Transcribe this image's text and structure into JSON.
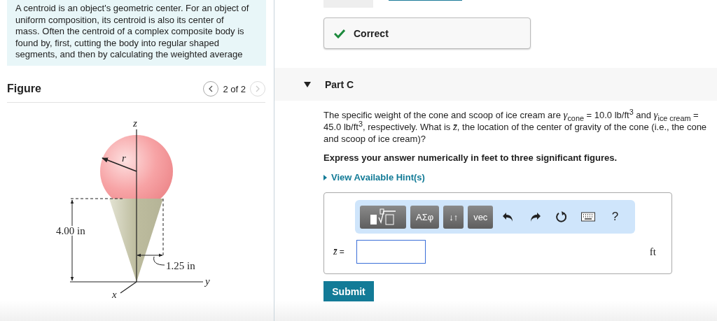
{
  "intro": {
    "text": "A centroid is an object's geometric center. For an object of uniform composition, its centroid is also its center of mass. Often the centroid of a complex composite body is found by, first, cutting the body into regular shaped segments, and then by calculating the weighted average"
  },
  "figure": {
    "title": "Figure",
    "pager": "2 of 2",
    "prev_disabled": false,
    "next_disabled": true,
    "labels": {
      "z_axis": "z",
      "radius": "r",
      "height": "4.00 in",
      "cone_radius": "1.25 in",
      "y_axis": "y",
      "x_axis": "x"
    }
  },
  "feedback": {
    "text": "Correct"
  },
  "part": {
    "title": "Part C",
    "expanded": true,
    "question": "The specific weight of the cone and scoop of ice cream are *γ*$_{cone}$ = 10.0 lb/ft$^{3}$ and *γ*$_{ice cream}$ = 45.0 lb/ft$^{3}$, respectively. What is *z̄*, the location of the center of gravity of the cone (i.e., the cone and scoop of ice cream)?",
    "instruction": "Express your answer numerically in feet to three significant figures.",
    "hint_link": "View Available Hint(s)"
  },
  "answer": {
    "toolbar": [
      {
        "kind": "template"
      },
      {
        "kind": "text",
        "label": "ΑΣφ"
      },
      {
        "kind": "text",
        "label": "↓↑"
      },
      {
        "kind": "text",
        "label": "vec"
      },
      {
        "kind": "undo"
      },
      {
        "kind": "redo"
      },
      {
        "kind": "reset"
      },
      {
        "kind": "keyboard"
      },
      {
        "kind": "help",
        "label": "?"
      }
    ],
    "variable": "*z̄* =",
    "unit": "ft"
  },
  "submit": "Submit"
}
